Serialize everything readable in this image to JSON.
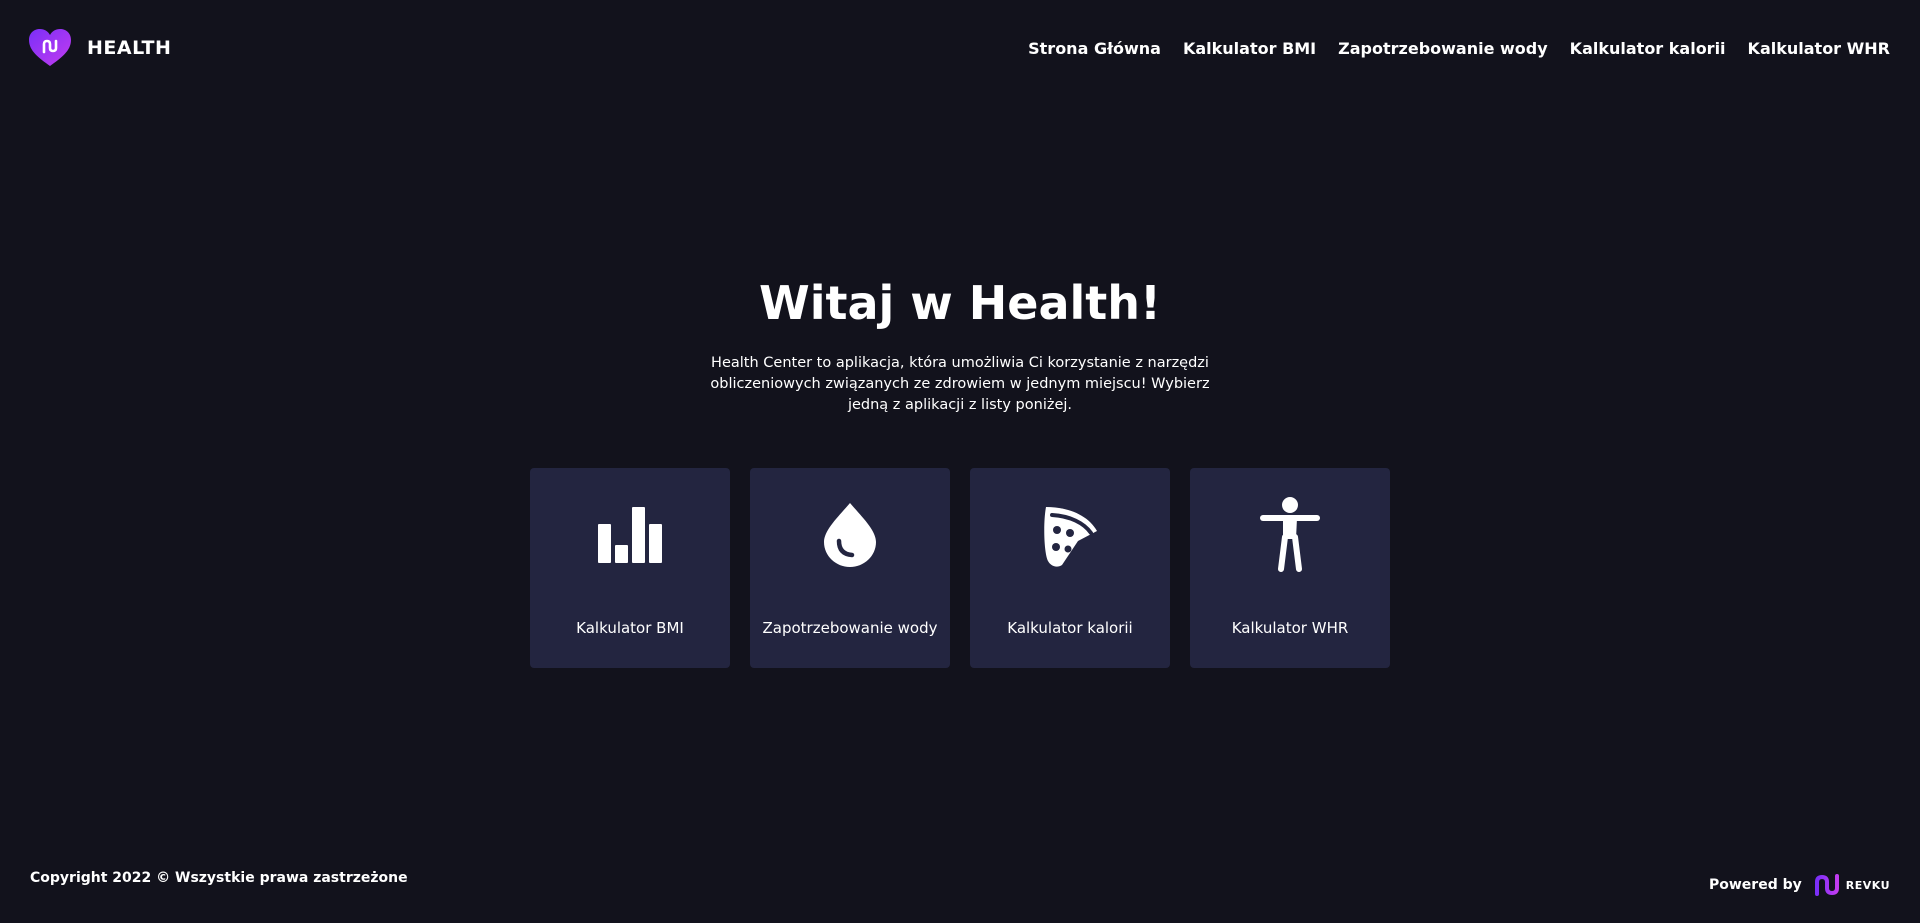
{
  "brand": {
    "name": "HEALTH",
    "logo_icon": "heart-logo-icon"
  },
  "nav": [
    {
      "label": "Strona Główna"
    },
    {
      "label": "Kalkulator BMI"
    },
    {
      "label": "Zapotrzebowanie wody"
    },
    {
      "label": "Kalkulator kalorii"
    },
    {
      "label": "Kalkulator WHR"
    }
  ],
  "hero": {
    "title": "Witaj w Health!",
    "description": "Health Center to aplikacja, która umożliwia Ci korzystanie z narzędzi obliczeniowych związanych ze zdrowiem w jednym miejscu! Wybierz jedną z aplikacji z listy poniżej."
  },
  "cards": [
    {
      "label": "Kalkulator BMI",
      "icon": "bar-chart-icon"
    },
    {
      "label": "Zapotrzebowanie wody",
      "icon": "water-drop-icon"
    },
    {
      "label": "Kalkulator kalorii",
      "icon": "pizza-icon"
    },
    {
      "label": "Kalkulator WHR",
      "icon": "body-icon"
    }
  ],
  "footer": {
    "copyright": "Copyright 2022 © Wszystkie prawa zastrzeżone",
    "powered_by": "Powered by",
    "powered_brand": "REVKU"
  },
  "colors": {
    "background": "#12121c",
    "card": "#232540",
    "accent_start": "#8b2cf5",
    "accent_end": "#c13bf2",
    "text": "#ffffff"
  }
}
